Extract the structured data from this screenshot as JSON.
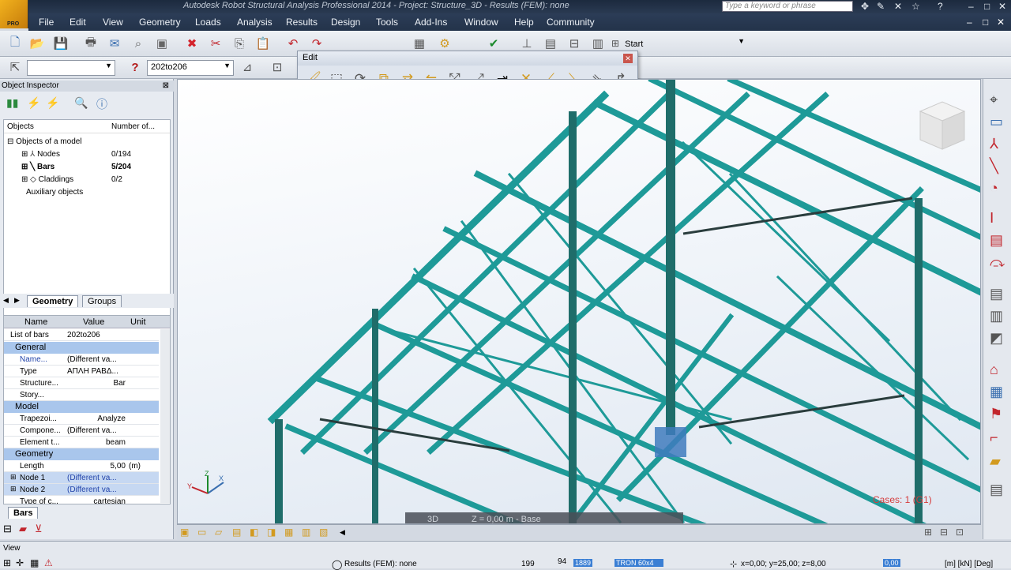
{
  "window": {
    "title": "Autodesk Robot Structural Analysis Professional 2014 - Project: Structure_3D - Results (FEM): none",
    "search_placeholder": "Type a keyword or phrase",
    "logo_text": "PRO"
  },
  "menu": [
    "File",
    "Edit",
    "View",
    "Geometry",
    "Loads",
    "Analysis",
    "Results",
    "Design",
    "Tools",
    "Add-Ins",
    "Window",
    "Help",
    "Community"
  ],
  "toolbar": {
    "selection_combo": "",
    "bar_selection": "202to206",
    "view_combo": "Start"
  },
  "edit_palette": {
    "title": "Edit"
  },
  "object_inspector": {
    "title": "Object Inspector",
    "tree_headers": [
      "Objects",
      "Number of..."
    ],
    "tree": [
      {
        "label": "Objects of a model",
        "count": ""
      },
      {
        "label": "Nodes",
        "count": "0/194"
      },
      {
        "label": "Bars",
        "count": "5/204"
      },
      {
        "label": "Claddings",
        "count": "0/2"
      },
      {
        "label": "Auxiliary objects",
        "count": ""
      }
    ],
    "tabs": [
      "Geometry",
      "Groups"
    ],
    "props_headers": [
      "Name",
      "Value",
      "Unit"
    ],
    "list_of_bars": {
      "name": "List of bars",
      "value": "202to206"
    },
    "groups": {
      "general": "General",
      "model": "Model",
      "geometry": "Geometry"
    },
    "general_rows": [
      {
        "n": "Name...",
        "v": "(Different va...",
        "u": ""
      },
      {
        "n": "Type",
        "v": "ΑΠΛΗ ΡΑΒΔ...",
        "u": ""
      },
      {
        "n": "Structure...",
        "v": "Bar",
        "u": ""
      },
      {
        "n": "Story...",
        "v": "",
        "u": ""
      }
    ],
    "model_rows": [
      {
        "n": "Trapezoi...",
        "v": "Analyze",
        "u": ""
      },
      {
        "n": "Compone...",
        "v": "(Different va...",
        "u": ""
      },
      {
        "n": "Element t...",
        "v": "beam",
        "u": ""
      }
    ],
    "geometry_rows": [
      {
        "n": "Length",
        "v": "5,00",
        "u": "(m)"
      },
      {
        "n": "Node 1",
        "v": "(Different va...",
        "u": ""
      },
      {
        "n": "Node 2",
        "v": "(Different va...",
        "u": ""
      },
      {
        "n": "Type of c...",
        "v": "cartesian",
        "u": ""
      }
    ],
    "bottom_tab": "Bars"
  },
  "viewport": {
    "mode": "3D",
    "level": "Z = 0,00 m - Base",
    "case_label": "Cases: 1 (G1)",
    "axis_labels": [
      "X",
      "Y",
      "Z"
    ]
  },
  "status": {
    "view": "View",
    "results": "Results (FEM): none",
    "num1": "199",
    "num2": "94",
    "chip1": "1889",
    "section": "TRON 60x4",
    "coords": "x=0,00; y=25,00; z=8,00",
    "chip2": "0,00",
    "units": "[m] [kN] [Deg]"
  },
  "colors": {
    "members": "#1e9a98",
    "dark_members": "#1f6d6a",
    "accent": "#3b7fd4"
  },
  "icons": [
    "pointer-icon",
    "new-file-icon",
    "open-icon",
    "save-icon",
    "print-icon",
    "delete-icon",
    "cut-icon",
    "copy-icon",
    "paste-icon",
    "undo-icon",
    "redo-icon",
    "view-cube-icon"
  ]
}
